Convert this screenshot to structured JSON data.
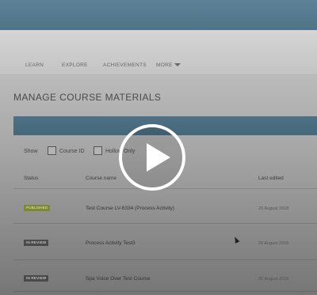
{
  "nav": {
    "items": [
      {
        "label": "LEARN"
      },
      {
        "label": "EXPLORE"
      },
      {
        "label": "ACHIEVEMENTS"
      },
      {
        "label": "MORE"
      }
    ]
  },
  "page_title": "MANAGE COURSE MATERIALS",
  "filters": {
    "show_label": "Show",
    "course_id_label": "Course ID",
    "hollow_only_label": "Hollow Only"
  },
  "table": {
    "columns": [
      "Status",
      "Course name",
      "Last edited"
    ],
    "rows": [
      {
        "status": "PUBLISHED",
        "status_color": "#7d8a2d",
        "name": "Test Course LV-6334 (Process Activity)",
        "edited": "20 August 2018"
      },
      {
        "status": "IN REVIEW",
        "status_color": "#4a4a4a",
        "name": "Process Activity Test3",
        "edited": "20 August 2018"
      },
      {
        "status": "IN REVIEW",
        "status_color": "#4a4a4a",
        "name": "Spa Voice Over Test Course",
        "edited": "20 August 2018"
      }
    ]
  },
  "overlay": {
    "icon": "play-icon"
  },
  "colors": {
    "topbar": "#557a8f",
    "panel_header": "#4a6d80",
    "published": "#7d8a2d"
  }
}
